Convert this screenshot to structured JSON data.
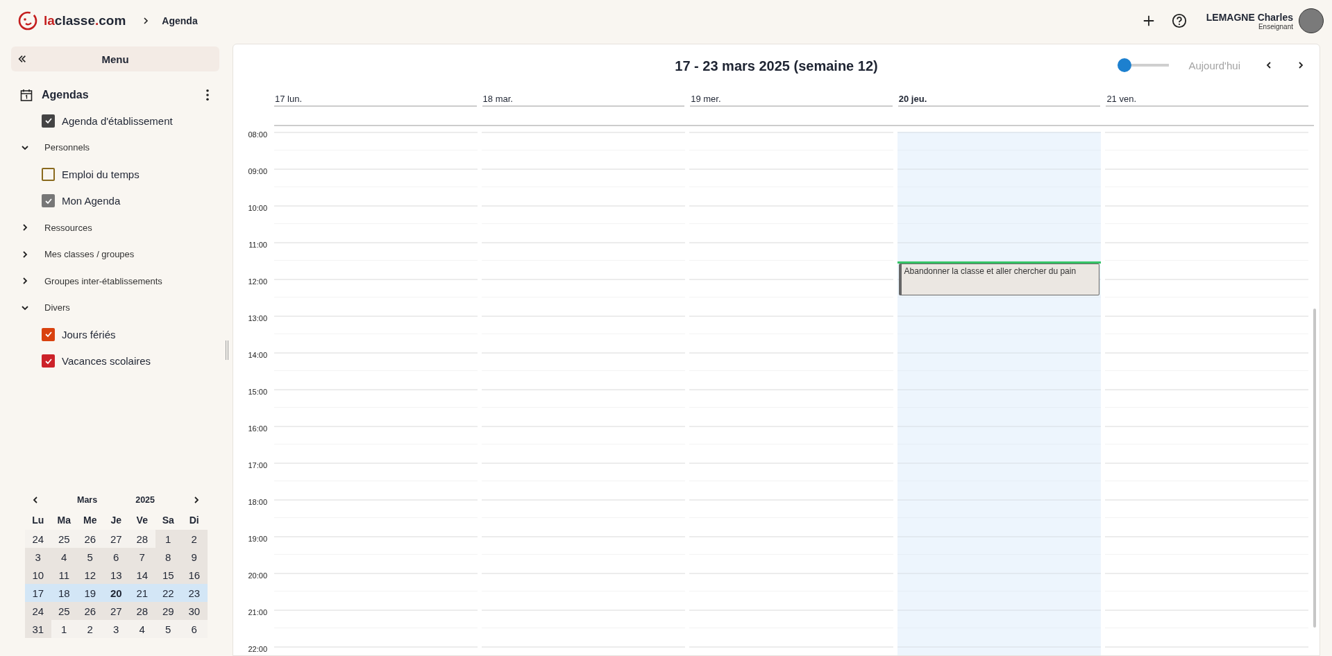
{
  "header": {
    "logo_prefix": "la",
    "logo_rest": "classe",
    "logo_dot": ".",
    "logo_tld": "com",
    "breadcrumb": "Agenda",
    "user": {
      "name": "LEMAGNE Charles",
      "role": "Enseignant"
    }
  },
  "sidebar": {
    "menu_label": "Menu",
    "section": "Agendas",
    "items": [
      {
        "kind": "checkbox",
        "label": "Agenda d'établissement",
        "checked": true,
        "color": "#444444"
      },
      {
        "kind": "group",
        "label": "Personnels",
        "expanded": true,
        "children": [
          {
            "kind": "checkbox",
            "label": "Emploi du temps",
            "checked": false,
            "color": "#8a6a1e"
          },
          {
            "kind": "checkbox",
            "label": "Mon Agenda",
            "checked": true,
            "color": "#777777"
          }
        ]
      },
      {
        "kind": "group",
        "label": "Ressources",
        "expanded": false
      },
      {
        "kind": "group",
        "label": "Mes classes / groupes",
        "expanded": false
      },
      {
        "kind": "group",
        "label": "Groupes inter-établissements",
        "expanded": false
      },
      {
        "kind": "group",
        "label": "Divers",
        "expanded": true,
        "children": [
          {
            "kind": "checkbox",
            "label": "Jours fériés",
            "checked": true,
            "color": "#d9410e"
          },
          {
            "kind": "checkbox",
            "label": "Vacances scolaires",
            "checked": true,
            "color": "#cc2229"
          }
        ]
      }
    ]
  },
  "mini_calendar": {
    "month": "Mars",
    "year": "2025",
    "weekdays": [
      "Lu",
      "Ma",
      "Me",
      "Je",
      "Ve",
      "Sa",
      "Di"
    ],
    "weeks": [
      {
        "selected": false,
        "days": [
          {
            "label": "24",
            "outside": true,
            "today": false
          },
          {
            "label": "25",
            "outside": true,
            "today": false
          },
          {
            "label": "26",
            "outside": true,
            "today": false
          },
          {
            "label": "27",
            "outside": true,
            "today": false
          },
          {
            "label": "28",
            "outside": true,
            "today": false
          },
          {
            "label": "1",
            "outside": false,
            "today": false
          },
          {
            "label": "2",
            "outside": false,
            "today": false
          }
        ]
      },
      {
        "selected": false,
        "days": [
          {
            "label": "3",
            "outside": false,
            "today": false
          },
          {
            "label": "4",
            "outside": false,
            "today": false
          },
          {
            "label": "5",
            "outside": false,
            "today": false
          },
          {
            "label": "6",
            "outside": false,
            "today": false
          },
          {
            "label": "7",
            "outside": false,
            "today": false
          },
          {
            "label": "8",
            "outside": false,
            "today": false
          },
          {
            "label": "9",
            "outside": false,
            "today": false
          }
        ]
      },
      {
        "selected": false,
        "days": [
          {
            "label": "10",
            "outside": false,
            "today": false
          },
          {
            "label": "11",
            "outside": false,
            "today": false
          },
          {
            "label": "12",
            "outside": false,
            "today": false
          },
          {
            "label": "13",
            "outside": false,
            "today": false
          },
          {
            "label": "14",
            "outside": false,
            "today": false
          },
          {
            "label": "15",
            "outside": false,
            "today": false
          },
          {
            "label": "16",
            "outside": false,
            "today": false
          }
        ]
      },
      {
        "selected": true,
        "days": [
          {
            "label": "17",
            "outside": false,
            "today": false
          },
          {
            "label": "18",
            "outside": false,
            "today": false
          },
          {
            "label": "19",
            "outside": false,
            "today": false
          },
          {
            "label": "20",
            "outside": false,
            "today": true
          },
          {
            "label": "21",
            "outside": false,
            "today": false
          },
          {
            "label": "22",
            "outside": false,
            "today": false
          },
          {
            "label": "23",
            "outside": false,
            "today": false
          }
        ]
      },
      {
        "selected": false,
        "days": [
          {
            "label": "24",
            "outside": false,
            "today": false
          },
          {
            "label": "25",
            "outside": false,
            "today": false
          },
          {
            "label": "26",
            "outside": false,
            "today": false
          },
          {
            "label": "27",
            "outside": false,
            "today": false
          },
          {
            "label": "28",
            "outside": false,
            "today": false
          },
          {
            "label": "29",
            "outside": false,
            "today": false
          },
          {
            "label": "30",
            "outside": false,
            "today": false
          }
        ]
      },
      {
        "selected": false,
        "days": [
          {
            "label": "31",
            "outside": false,
            "today": false
          },
          {
            "label": "1",
            "outside": true,
            "today": false
          },
          {
            "label": "2",
            "outside": true,
            "today": false
          },
          {
            "label": "3",
            "outside": true,
            "today": false
          },
          {
            "label": "4",
            "outside": true,
            "today": false
          },
          {
            "label": "5",
            "outside": true,
            "today": false
          },
          {
            "label": "6",
            "outside": true,
            "today": false
          }
        ]
      }
    ]
  },
  "calendar": {
    "title": "17 - 23 mars 2025 (semaine 12)",
    "zoom_slider": {
      "level": 0
    },
    "today_button": "Aujourd'hui",
    "days": [
      {
        "label": "17 lun.",
        "selected": false
      },
      {
        "label": "18 mar.",
        "selected": false
      },
      {
        "label": "19 mer.",
        "selected": false
      },
      {
        "label": "20 jeu.",
        "selected": true,
        "events": [
          {
            "title": "Abandonner la classe et aller chercher du pain"
          }
        ]
      },
      {
        "label": "21 ven.",
        "selected": false
      }
    ],
    "hours": [
      "08:00",
      "09:00",
      "10:00",
      "11:00",
      "12:00",
      "13:00",
      "14:00",
      "15:00",
      "16:00",
      "17:00",
      "18:00",
      "19:00",
      "20:00",
      "21:00",
      "22:00"
    ]
  }
}
